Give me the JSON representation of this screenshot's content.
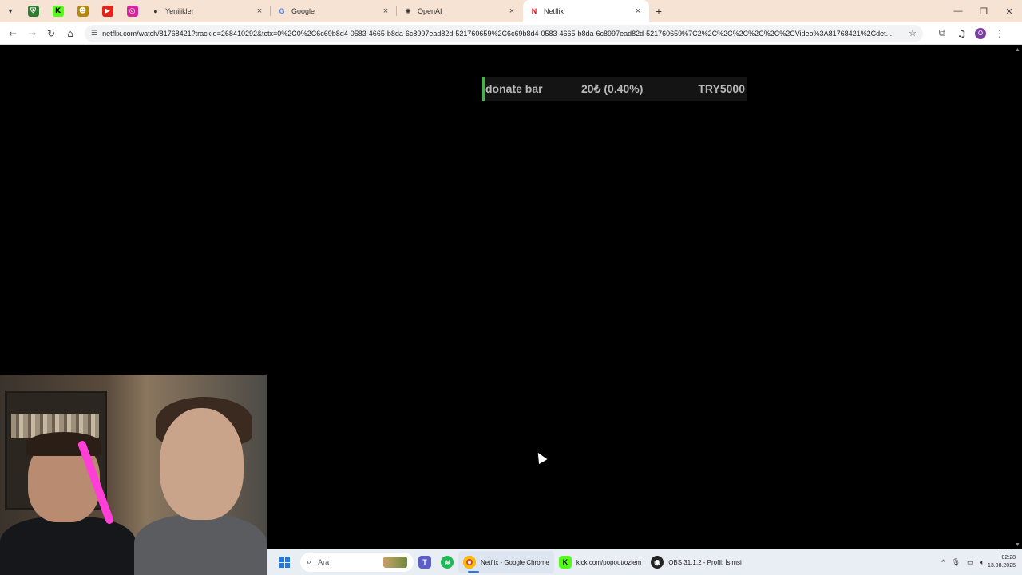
{
  "browser": {
    "tabs": [
      {
        "title": "Yenilikler",
        "active": false
      },
      {
        "title": "Google",
        "active": false
      },
      {
        "title": "OpenAI",
        "active": false
      },
      {
        "title": "Netflix",
        "active": true
      }
    ],
    "url": "netflix.com/watch/81768421?trackId=268410292&tctx=0%2C0%2C6c69b8d4-0583-4665-b8da-6c8997ead82d-521760659%2C6c69b8d4-0583-4665-b8da-6c8997ead82d-521760659%7C2%2C%2C%2C%2C%2C%2CVideo%3A81768421%2Cdet...",
    "profile_initial": "O"
  },
  "overlay": {
    "donate_label": "donate bar",
    "donate_amount": "20₺ (0.40%)",
    "donate_goal": "TRY5000",
    "progress_percent": 0.4,
    "accent_color": "#4caf50"
  },
  "taskbar": {
    "search_placeholder": "Ara",
    "apps": [
      {
        "label": "Netflix - Google Chrome"
      },
      {
        "label": "kick.com/popout/ozlem"
      },
      {
        "label": "OBS 31.1.2 - Profil: İsimsi"
      }
    ],
    "time": "02:28",
    "date": "13.08.2025"
  }
}
